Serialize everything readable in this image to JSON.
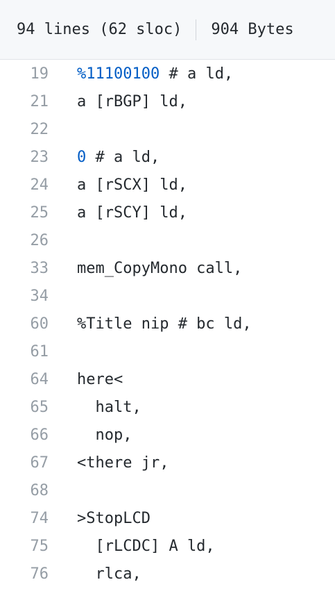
{
  "file_info": {
    "lines": "94 lines (62 sloc)",
    "size": "904 Bytes"
  },
  "colors": {
    "background": "#ffffff",
    "header_background": "#f6f8fa",
    "line_number": "#959da5",
    "code_text": "#24292e",
    "numeric_literal": "#005cc5"
  },
  "code_lines": [
    {
      "num": "19",
      "tokens": [
        {
          "text": "%11100100",
          "kind": "number"
        },
        {
          "text": " # a ld,",
          "kind": "plain"
        }
      ]
    },
    {
      "num": "21",
      "tokens": [
        {
          "text": "a [rBGP] ld,",
          "kind": "plain"
        }
      ]
    },
    {
      "num": "22",
      "tokens": []
    },
    {
      "num": "23",
      "tokens": [
        {
          "text": "0",
          "kind": "number"
        },
        {
          "text": " # a ld,",
          "kind": "plain"
        }
      ]
    },
    {
      "num": "24",
      "tokens": [
        {
          "text": "a [rSCX] ld,",
          "kind": "plain"
        }
      ]
    },
    {
      "num": "25",
      "tokens": [
        {
          "text": "a [rSCY] ld,",
          "kind": "plain"
        }
      ]
    },
    {
      "num": "26",
      "tokens": []
    },
    {
      "num": "33",
      "tokens": [
        {
          "text": "mem_CopyMono call,",
          "kind": "plain"
        }
      ]
    },
    {
      "num": "34",
      "tokens": []
    },
    {
      "num": "60",
      "tokens": [
        {
          "text": "%Title nip # bc ld,",
          "kind": "plain"
        }
      ]
    },
    {
      "num": "61",
      "tokens": []
    },
    {
      "num": "64",
      "tokens": [
        {
          "text": "here<",
          "kind": "plain"
        }
      ]
    },
    {
      "num": "65",
      "tokens": [
        {
          "text": "  halt,",
          "kind": "plain"
        }
      ]
    },
    {
      "num": "66",
      "tokens": [
        {
          "text": "  nop,",
          "kind": "plain"
        }
      ]
    },
    {
      "num": "67",
      "tokens": [
        {
          "text": "<there jr,",
          "kind": "plain"
        }
      ]
    },
    {
      "num": "68",
      "tokens": []
    },
    {
      "num": "74",
      "tokens": [
        {
          "text": ">StopLCD",
          "kind": "plain"
        }
      ]
    },
    {
      "num": "75",
      "tokens": [
        {
          "text": "  [rLCDC] A ld,",
          "kind": "plain"
        }
      ]
    },
    {
      "num": "76",
      "tokens": [
        {
          "text": "  rlca,",
          "kind": "plain"
        }
      ]
    }
  ]
}
